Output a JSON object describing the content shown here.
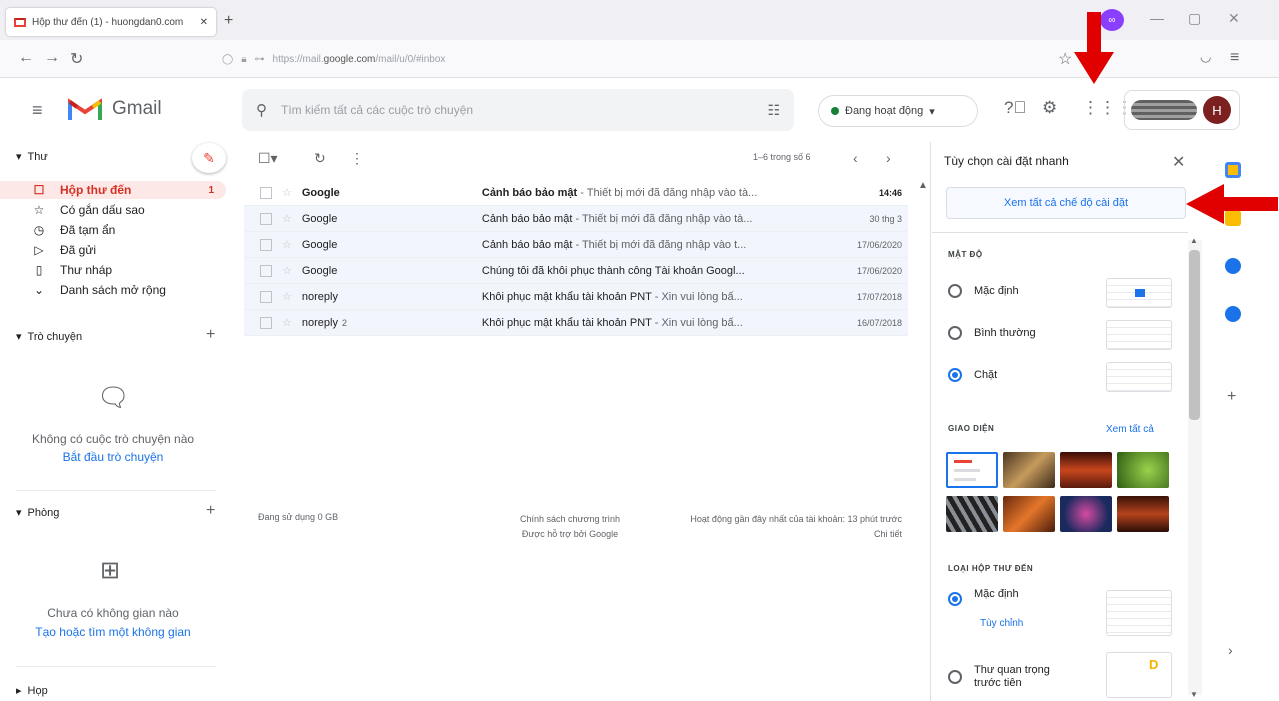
{
  "browser": {
    "tab_title": "Hộp thư đến (1) - huongdan0.com",
    "new_tab": "+",
    "url_prefix": "https://mail.",
    "url_host": "google.com",
    "url_suffix": "/mail/u/0/#inbox",
    "profile_badge": "∞"
  },
  "header": {
    "app_name": "Gmail",
    "search_placeholder": "Tìm kiếm tất cả các cuộc trò chuyện",
    "status": "Đang hoạt động",
    "avatar_letter": "H"
  },
  "sidebar": {
    "mail_section": "Thư",
    "items": [
      {
        "icon": "☐",
        "label": "Hộp thư đến",
        "count": "1",
        "active": true
      },
      {
        "icon": "☆",
        "label": "Có gắn dấu sao",
        "count": "",
        "active": false
      },
      {
        "icon": "◷",
        "label": "Đã tạm ẩn",
        "count": "",
        "active": false
      },
      {
        "icon": "▷",
        "label": "Đã gửi",
        "count": "",
        "active": false
      },
      {
        "icon": "▯",
        "label": "Thư nháp",
        "count": "",
        "active": false
      },
      {
        "icon": "⌄",
        "label": "Danh sách mở rộng",
        "count": "",
        "active": false
      }
    ],
    "chat_section": "Trò chuyện",
    "chat_empty": "Không có cuộc trò chuyện nào",
    "chat_start": "Bắt đầu trò chuyện",
    "rooms_section": "Phòng",
    "rooms_empty": "Chưa có không gian nào",
    "rooms_find": "Tạo hoặc tìm một không gian",
    "meet_section": "Họp"
  },
  "mail_list": {
    "pager": "1–6 trong số 6",
    "rows": [
      {
        "from": "Google",
        "count": "",
        "subject": "Cảnh báo bảo mật",
        "snippet": " - Thiết bị mới đã đăng nhập vào tà...",
        "date": "14:46",
        "unread": true
      },
      {
        "from": "Google",
        "count": "",
        "subject": "Cảnh báo bảo mật",
        "snippet": " - Thiết bị mới đã đăng nhập vào tà...",
        "date": "30 thg 3",
        "unread": false
      },
      {
        "from": "Google",
        "count": "",
        "subject": "Cảnh báo bảo mật",
        "snippet": " - Thiết bị mới đã đăng nhập vào t...",
        "date": "17/06/2020",
        "unread": false
      },
      {
        "from": "Google",
        "count": "",
        "subject": "Chúng tôi đã khôi phục thành công Tài khoản Googl...",
        "snippet": "",
        "date": "17/06/2020",
        "unread": false
      },
      {
        "from": "noreply",
        "count": "",
        "subject": "Khôi phục mật khẩu tài khoản PNT",
        "snippet": " - Xin vui lòng bấ...",
        "date": "17/07/2018",
        "unread": false
      },
      {
        "from": "noreply",
        "count": "2",
        "subject": "Khôi phục mật khẩu tài khoản PNT",
        "snippet": " - Xin vui lòng bấ...",
        "date": "16/07/2018",
        "unread": false
      }
    ],
    "footer_storage": "Đang sử dụng 0 GB",
    "footer_policy": "Chính sách chương trình",
    "footer_powered": "Được hỗ trợ bởi Google",
    "footer_activity": "Hoạt động gần đây nhất của tài khoản: 13 phút trước",
    "footer_details": "Chi tiết"
  },
  "quick_settings": {
    "title": "Tùy chọn cài đặt nhanh",
    "see_all": "Xem tất cả chế độ cài đặt",
    "density_label": "MẬT ĐỘ",
    "density_options": [
      "Mặc định",
      "Bình thường",
      "Chặt"
    ],
    "density_selected": 2,
    "theme_label": "GIAO DIỆN",
    "theme_view_all": "Xem tất cả",
    "inbox_type_label": "LOẠI HỘP THƯ ĐẾN",
    "inbox_default": "Mặc định",
    "inbox_customize": "Tùy chỉnh",
    "inbox_important": "Thư quan trọng trước tiên"
  },
  "colors": {
    "accent": "#1a73e8",
    "inbox_active": "#d93025",
    "annotation": "#e00000"
  }
}
